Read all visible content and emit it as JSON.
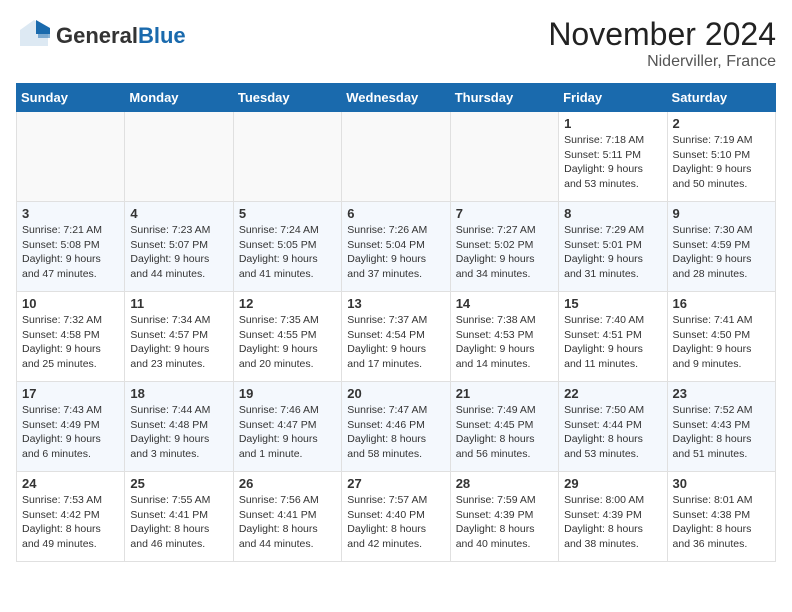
{
  "header": {
    "logo_general": "General",
    "logo_blue": "Blue",
    "month_title": "November 2024",
    "location": "Niderviller, France"
  },
  "days_of_week": [
    "Sunday",
    "Monday",
    "Tuesday",
    "Wednesday",
    "Thursday",
    "Friday",
    "Saturday"
  ],
  "weeks": [
    [
      {
        "day": "",
        "info": ""
      },
      {
        "day": "",
        "info": ""
      },
      {
        "day": "",
        "info": ""
      },
      {
        "day": "",
        "info": ""
      },
      {
        "day": "",
        "info": ""
      },
      {
        "day": "1",
        "info": "Sunrise: 7:18 AM\nSunset: 5:11 PM\nDaylight: 9 hours and 53 minutes."
      },
      {
        "day": "2",
        "info": "Sunrise: 7:19 AM\nSunset: 5:10 PM\nDaylight: 9 hours and 50 minutes."
      }
    ],
    [
      {
        "day": "3",
        "info": "Sunrise: 7:21 AM\nSunset: 5:08 PM\nDaylight: 9 hours and 47 minutes."
      },
      {
        "day": "4",
        "info": "Sunrise: 7:23 AM\nSunset: 5:07 PM\nDaylight: 9 hours and 44 minutes."
      },
      {
        "day": "5",
        "info": "Sunrise: 7:24 AM\nSunset: 5:05 PM\nDaylight: 9 hours and 41 minutes."
      },
      {
        "day": "6",
        "info": "Sunrise: 7:26 AM\nSunset: 5:04 PM\nDaylight: 9 hours and 37 minutes."
      },
      {
        "day": "7",
        "info": "Sunrise: 7:27 AM\nSunset: 5:02 PM\nDaylight: 9 hours and 34 minutes."
      },
      {
        "day": "8",
        "info": "Sunrise: 7:29 AM\nSunset: 5:01 PM\nDaylight: 9 hours and 31 minutes."
      },
      {
        "day": "9",
        "info": "Sunrise: 7:30 AM\nSunset: 4:59 PM\nDaylight: 9 hours and 28 minutes."
      }
    ],
    [
      {
        "day": "10",
        "info": "Sunrise: 7:32 AM\nSunset: 4:58 PM\nDaylight: 9 hours and 25 minutes."
      },
      {
        "day": "11",
        "info": "Sunrise: 7:34 AM\nSunset: 4:57 PM\nDaylight: 9 hours and 23 minutes."
      },
      {
        "day": "12",
        "info": "Sunrise: 7:35 AM\nSunset: 4:55 PM\nDaylight: 9 hours and 20 minutes."
      },
      {
        "day": "13",
        "info": "Sunrise: 7:37 AM\nSunset: 4:54 PM\nDaylight: 9 hours and 17 minutes."
      },
      {
        "day": "14",
        "info": "Sunrise: 7:38 AM\nSunset: 4:53 PM\nDaylight: 9 hours and 14 minutes."
      },
      {
        "day": "15",
        "info": "Sunrise: 7:40 AM\nSunset: 4:51 PM\nDaylight: 9 hours and 11 minutes."
      },
      {
        "day": "16",
        "info": "Sunrise: 7:41 AM\nSunset: 4:50 PM\nDaylight: 9 hours and 9 minutes."
      }
    ],
    [
      {
        "day": "17",
        "info": "Sunrise: 7:43 AM\nSunset: 4:49 PM\nDaylight: 9 hours and 6 minutes."
      },
      {
        "day": "18",
        "info": "Sunrise: 7:44 AM\nSunset: 4:48 PM\nDaylight: 9 hours and 3 minutes."
      },
      {
        "day": "19",
        "info": "Sunrise: 7:46 AM\nSunset: 4:47 PM\nDaylight: 9 hours and 1 minute."
      },
      {
        "day": "20",
        "info": "Sunrise: 7:47 AM\nSunset: 4:46 PM\nDaylight: 8 hours and 58 minutes."
      },
      {
        "day": "21",
        "info": "Sunrise: 7:49 AM\nSunset: 4:45 PM\nDaylight: 8 hours and 56 minutes."
      },
      {
        "day": "22",
        "info": "Sunrise: 7:50 AM\nSunset: 4:44 PM\nDaylight: 8 hours and 53 minutes."
      },
      {
        "day": "23",
        "info": "Sunrise: 7:52 AM\nSunset: 4:43 PM\nDaylight: 8 hours and 51 minutes."
      }
    ],
    [
      {
        "day": "24",
        "info": "Sunrise: 7:53 AM\nSunset: 4:42 PM\nDaylight: 8 hours and 49 minutes."
      },
      {
        "day": "25",
        "info": "Sunrise: 7:55 AM\nSunset: 4:41 PM\nDaylight: 8 hours and 46 minutes."
      },
      {
        "day": "26",
        "info": "Sunrise: 7:56 AM\nSunset: 4:41 PM\nDaylight: 8 hours and 44 minutes."
      },
      {
        "day": "27",
        "info": "Sunrise: 7:57 AM\nSunset: 4:40 PM\nDaylight: 8 hours and 42 minutes."
      },
      {
        "day": "28",
        "info": "Sunrise: 7:59 AM\nSunset: 4:39 PM\nDaylight: 8 hours and 40 minutes."
      },
      {
        "day": "29",
        "info": "Sunrise: 8:00 AM\nSunset: 4:39 PM\nDaylight: 8 hours and 38 minutes."
      },
      {
        "day": "30",
        "info": "Sunrise: 8:01 AM\nSunset: 4:38 PM\nDaylight: 8 hours and 36 minutes."
      }
    ]
  ]
}
